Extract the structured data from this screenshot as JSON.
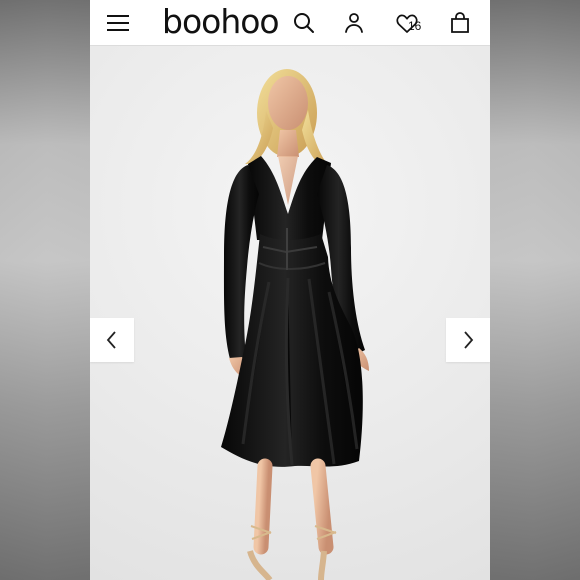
{
  "brand": {
    "name": "boohoo"
  },
  "header": {
    "menu_icon": "hamburger-icon",
    "search_icon": "search-icon",
    "account_icon": "user-icon",
    "wishlist_icon": "heart-icon",
    "bag_icon": "shopping-bag-icon",
    "wishlist_count": "16"
  },
  "gallery": {
    "prev_icon": "chevron-left-icon",
    "next_icon": "chevron-right-icon"
  },
  "colors": {
    "header_bg": "#ffffff",
    "hero_bg": "#ececec",
    "dress": "#121212"
  }
}
